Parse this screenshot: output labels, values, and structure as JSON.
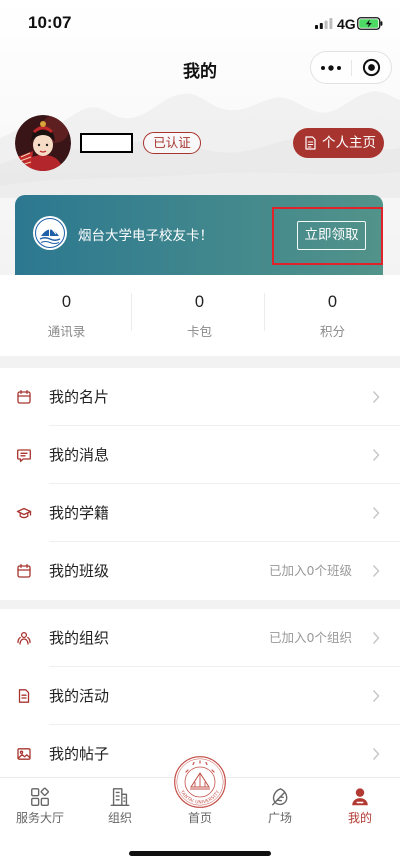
{
  "status_bar": {
    "time": "10:07",
    "network": "4G",
    "signal_icon": "cellular-signal-icon",
    "battery_icon": "battery-charging-icon"
  },
  "nav": {
    "title": "我的",
    "more_icon": "more-dots-icon",
    "close_icon": "target-circle-icon"
  },
  "profile": {
    "verified_badge": "已认证",
    "homepage_button": {
      "label": "个人主页",
      "icon": "document-icon"
    }
  },
  "alumni_card": {
    "logo_icon": "yantai-university-logo",
    "text": "烟台大学电子校友卡！",
    "claim_button": "立即领取"
  },
  "stats": [
    {
      "value": "0",
      "label": "通讯录"
    },
    {
      "value": "0",
      "label": "卡包"
    },
    {
      "value": "0",
      "label": "积分"
    }
  ],
  "menu_group_1": [
    {
      "label": "我的名片",
      "icon": "card-icon",
      "extra": ""
    },
    {
      "label": "我的消息",
      "icon": "message-icon",
      "extra": ""
    },
    {
      "label": "我的学籍",
      "icon": "graduation-cap-icon",
      "extra": ""
    },
    {
      "label": "我的班级",
      "icon": "calendar-icon",
      "extra": "已加入0个班级"
    }
  ],
  "menu_group_2": [
    {
      "label": "我的组织",
      "icon": "organization-icon",
      "extra": "已加入0个组织"
    },
    {
      "label": "我的活动",
      "icon": "document-icon",
      "extra": ""
    },
    {
      "label": "我的帖子",
      "icon": "image-icon",
      "extra": ""
    }
  ],
  "tab_bar": {
    "items": [
      {
        "label": "服务大厅",
        "icon": "grid-icon",
        "active": false
      },
      {
        "label": "组织",
        "icon": "building-icon",
        "active": false
      },
      {
        "label": "首页",
        "icon": "university-emblem-icon",
        "active": false
      },
      {
        "label": "广场",
        "icon": "leaf-icon",
        "active": false
      },
      {
        "label": "我的",
        "icon": "person-icon",
        "active": true
      }
    ],
    "emblem_text": "YANTAI UNIVERSITY"
  },
  "colors": {
    "brand_red": "#a8342f",
    "card_gradient_start": "#2c7890",
    "card_gradient_end": "#52938a",
    "highlight_red": "#e0232b",
    "tab_active": "#b23a33",
    "text_primary": "#222222",
    "text_secondary": "#8a8a8a",
    "battery_green": "#4cd964"
  }
}
